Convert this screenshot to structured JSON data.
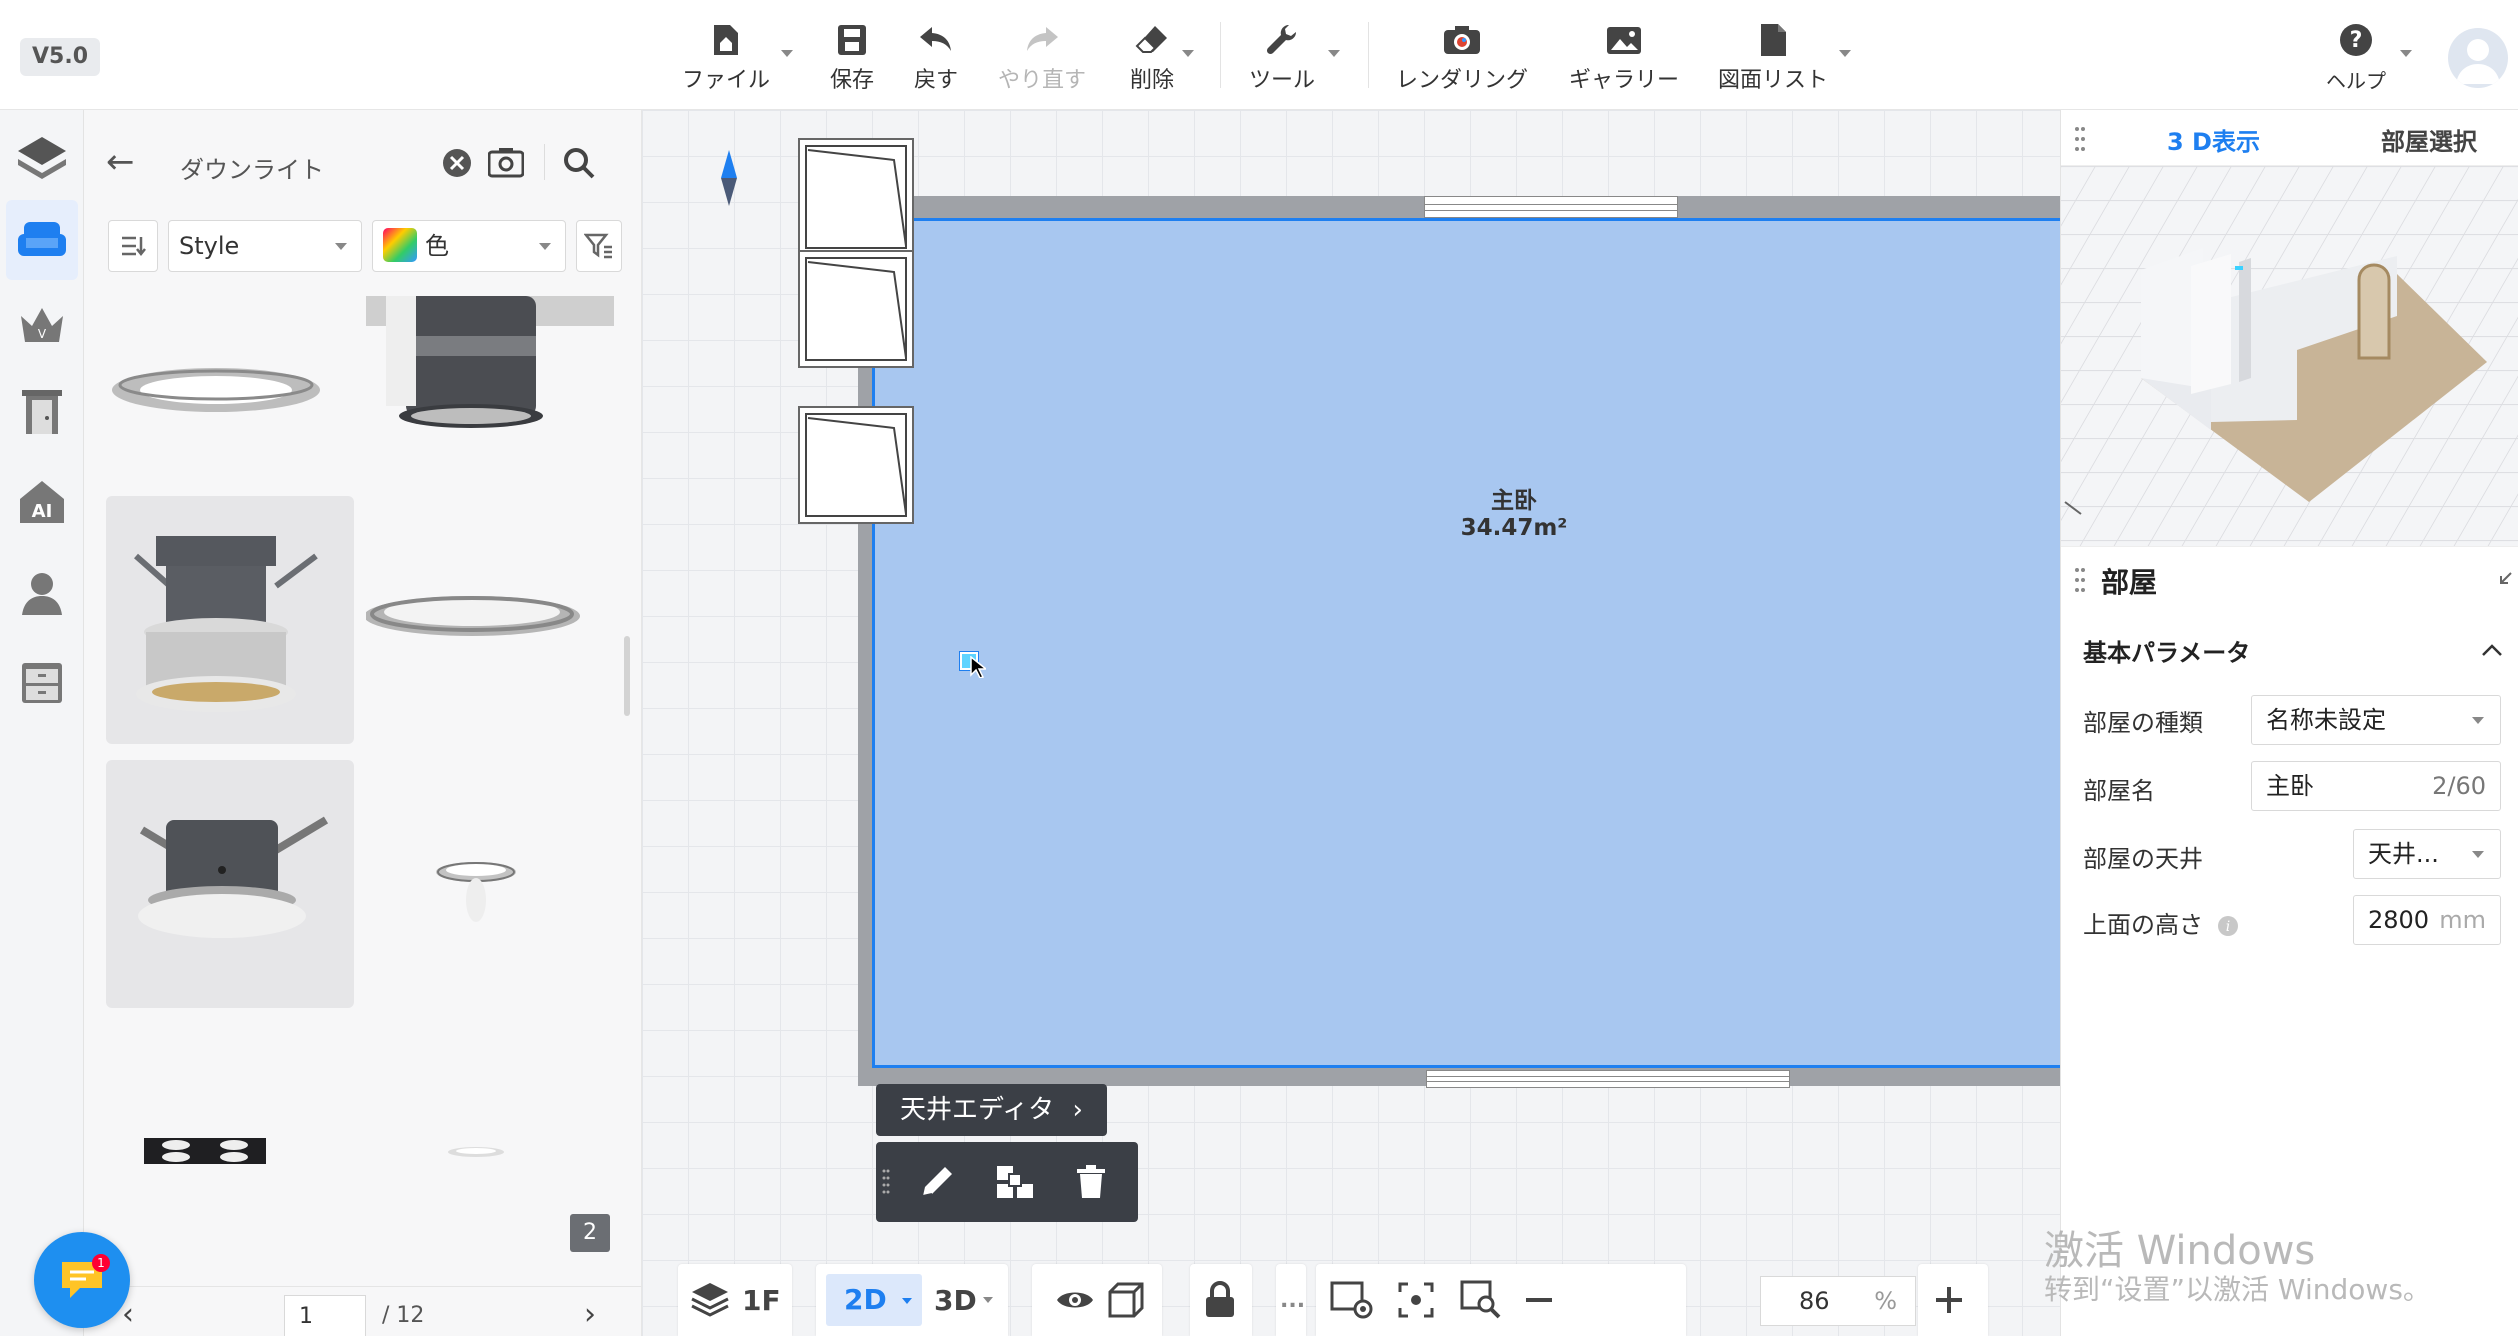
{
  "version": "V5.0",
  "toolbar": {
    "file": "ファイル",
    "save": "保存",
    "undo": "戻す",
    "redo": "やり直す",
    "delete": "削除",
    "tools": "ツール",
    "rendering": "レンダリング",
    "gallery": "ギャラリー",
    "drawing_list": "図面リスト",
    "help": "ヘルプ"
  },
  "catalog": {
    "title": "ダウンライト",
    "style_select": "Style",
    "color_select": "色",
    "page_badge": "2",
    "page_current": "1",
    "page_total": "/ 12"
  },
  "canvas": {
    "room_name": "主卧",
    "room_area": "34.47m²",
    "ceiling_editor": "天井エディタ",
    "floor_label": "1F",
    "view_2d": "2D",
    "view_3d": "3D",
    "more": "...",
    "zoom_value": "86",
    "zoom_unit": "%"
  },
  "right_panel": {
    "tab_3d": "3 D表示",
    "tab_room_select": "部屋選択",
    "props_title": "部屋",
    "section_title": "基本パラメータ",
    "room_type_label": "部屋の種類",
    "room_type_value": "名称未設定",
    "room_name_label": "部屋名",
    "room_name_value": "主卧",
    "room_name_count": "2/60",
    "ceiling_label": "部屋の天井",
    "ceiling_value": "天井...",
    "top_height_label": "上面の高さ",
    "top_height_value": "2800",
    "top_height_unit": "mm"
  },
  "watermark": {
    "line1": "激活 Windows",
    "line2": "转到“设置”以激活 Windows。"
  },
  "colors": {
    "accent": "#1e7ff0",
    "floor": "#a8c7f0",
    "wall": "#9fa2a7",
    "dark_panel": "#3b3f46"
  }
}
